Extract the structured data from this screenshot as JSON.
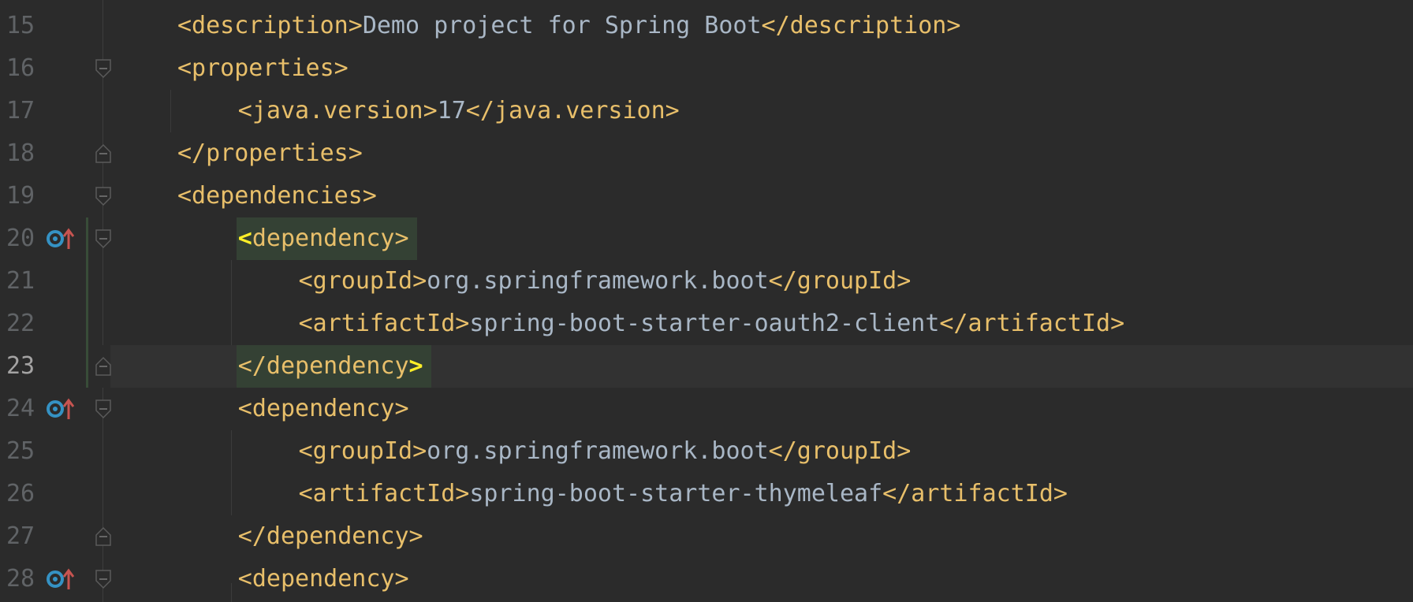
{
  "editor": {
    "lines": [
      {
        "num": "15",
        "indent": 1,
        "open": "<description>",
        "text": "Demo project for Spring Boot",
        "close": "</description>",
        "fold": "none",
        "icon": false
      },
      {
        "num": "16",
        "indent": 1,
        "open": "<properties>",
        "text": "",
        "close": "",
        "fold": "open",
        "icon": false
      },
      {
        "num": "17",
        "indent": 2,
        "open": "<java.version>",
        "text": "17",
        "close": "</java.version>",
        "fold": "none",
        "icon": false
      },
      {
        "num": "18",
        "indent": 1,
        "open": "</properties>",
        "text": "",
        "close": "",
        "fold": "close",
        "icon": false
      },
      {
        "num": "19",
        "indent": 1,
        "open": "<dependencies>",
        "text": "",
        "close": "",
        "fold": "open",
        "icon": false
      },
      {
        "num": "20",
        "indent": 2,
        "open": "<dependency>",
        "text": "",
        "close": "",
        "fold": "open",
        "icon": true
      },
      {
        "num": "21",
        "indent": 3,
        "open": "<groupId>",
        "text": "org.springframework.boot",
        "close": "</groupId>",
        "fold": "none",
        "icon": false
      },
      {
        "num": "22",
        "indent": 3,
        "open": "<artifactId>",
        "text": "spring-boot-starter-oauth2-client",
        "close": "</artifactId>",
        "fold": "none",
        "icon": false
      },
      {
        "num": "23",
        "indent": 2,
        "open": "</dependency>",
        "text": "",
        "close": "",
        "fold": "close",
        "icon": false,
        "current": true
      },
      {
        "num": "24",
        "indent": 2,
        "open": "<dependency>",
        "text": "",
        "close": "",
        "fold": "open",
        "icon": true
      },
      {
        "num": "25",
        "indent": 3,
        "open": "<groupId>",
        "text": "org.springframework.boot",
        "close": "</groupId>",
        "fold": "none",
        "icon": false
      },
      {
        "num": "26",
        "indent": 3,
        "open": "<artifactId>",
        "text": "spring-boot-starter-thymeleaf",
        "close": "</artifactId>",
        "fold": "none",
        "icon": false
      },
      {
        "num": "27",
        "indent": 2,
        "open": "</dependency>",
        "text": "",
        "close": "",
        "fold": "close",
        "icon": false
      },
      {
        "num": "28",
        "indent": 2,
        "open": "<dependency>",
        "text": "",
        "close": "",
        "fold": "open",
        "icon": true
      }
    ],
    "colors": {
      "background": "#2b2b2b",
      "current_line": "#323232",
      "tag": "#e8bf6a",
      "text": "#a9b7c6",
      "line_number": "#606366",
      "match_highlight": "#344134",
      "bracket_match": "#ffef28",
      "icon_blue": "#3592c4",
      "icon_red": "#c75450"
    },
    "icons": {
      "gutter": "overriding-dependency-icon",
      "fold_open": "fold-open-icon",
      "fold_close": "fold-close-icon"
    }
  }
}
